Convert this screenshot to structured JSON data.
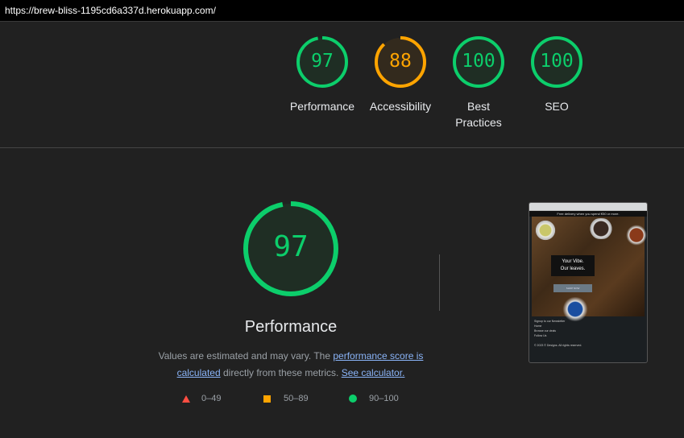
{
  "url": "https://brew-bliss-1195cd6a337d.herokuapp.com/",
  "colors": {
    "pass": "#0cce6b",
    "average": "#ffa400",
    "fail": "#ff4e42"
  },
  "categories": [
    {
      "label": "Performance",
      "score": "97",
      "rating": "pass"
    },
    {
      "label": "Accessibility",
      "score": "88",
      "rating": "average"
    },
    {
      "label": "Best Practices",
      "score": "100",
      "rating": "pass"
    },
    {
      "label": "SEO",
      "score": "100",
      "rating": "pass"
    }
  ],
  "performance": {
    "score": "97",
    "title": "Performance",
    "desc_prefix": "Values are estimated and may vary. The ",
    "link_score": "performance score is calculated",
    "desc_mid": " directly from these metrics. ",
    "link_calc": "See calculator."
  },
  "legend": {
    "fail": "0–49",
    "average": "50–89",
    "pass": "90–100"
  },
  "screenshot": {
    "banner": "Free delivery when you spend €50 or more.",
    "hero_line1": "Your Vibe.",
    "hero_line2": "Our leaves.",
    "hero_button": "SHOP NOW",
    "footer": [
      "Signup to our Newsletter",
      "Home",
      "Browse our deals",
      "Follow Us",
      "© 2023 © Designs. All rights reserved."
    ]
  }
}
